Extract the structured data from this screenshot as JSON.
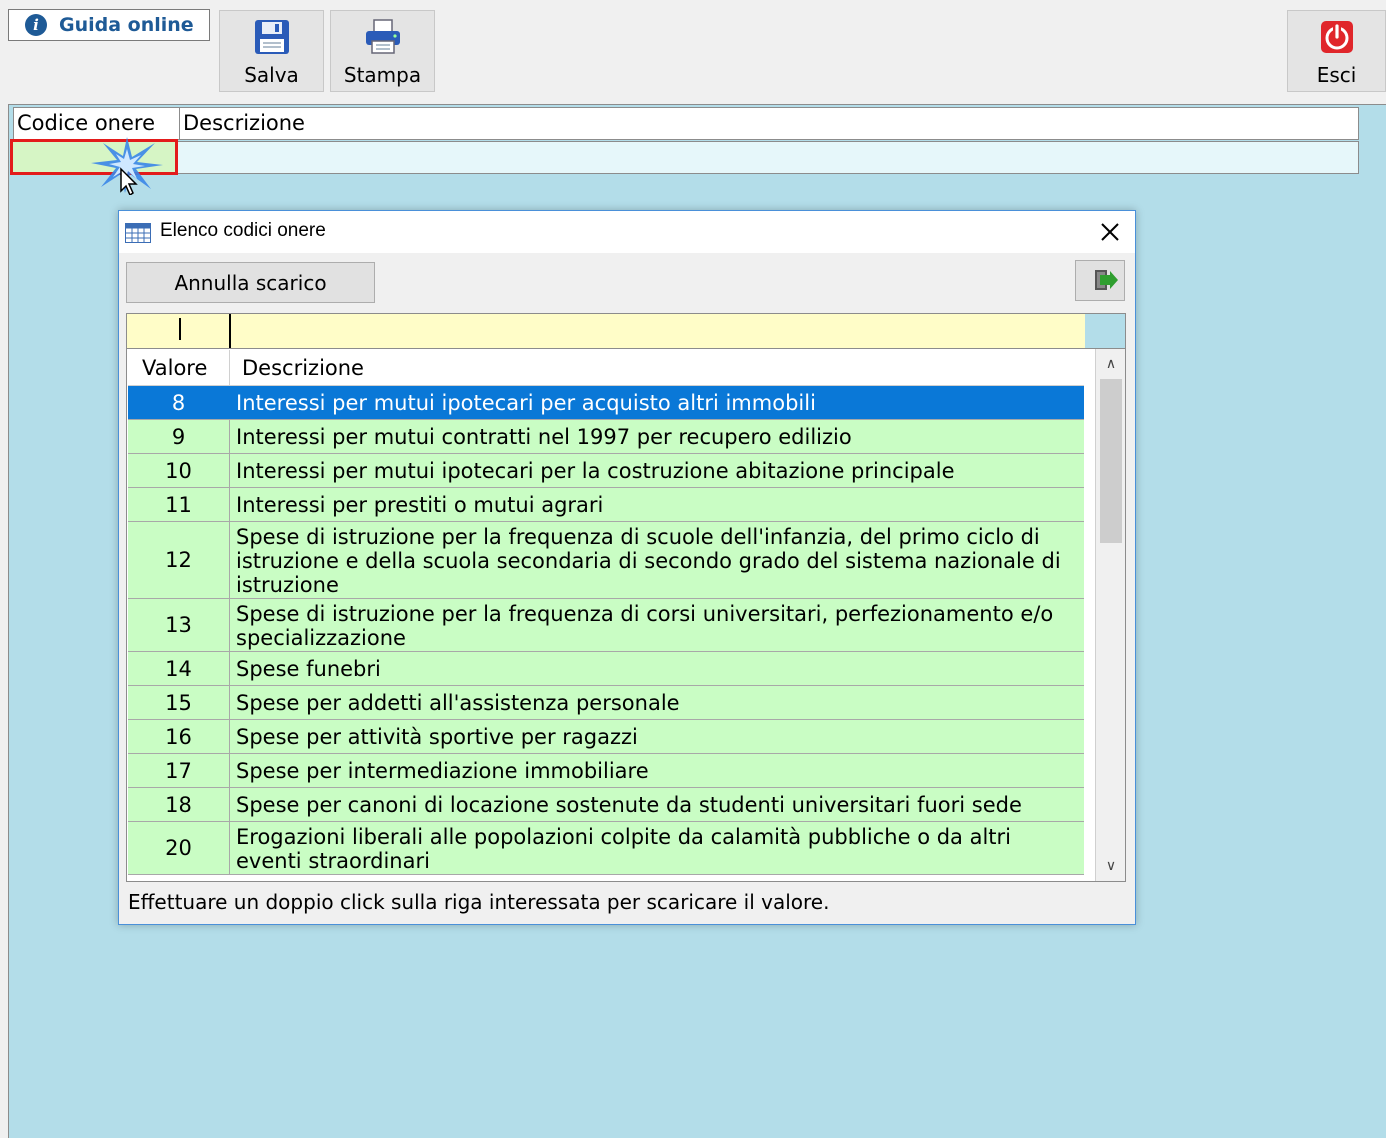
{
  "toolbar": {
    "guida_label": "Guida online",
    "salva_label": "Salva",
    "stampa_label": "Stampa",
    "esci_label": "Esci"
  },
  "form": {
    "col_codice": "Codice onere",
    "col_descrizione": "Descrizione",
    "codice_value": "",
    "descrizione_value": ""
  },
  "dialog": {
    "title": "Elenco codici onere",
    "annulla_label": "Annulla scarico",
    "filter_valore": "",
    "filter_descrizione": "",
    "columns": {
      "valore": "Valore",
      "descrizione": "Descrizione"
    },
    "rows": [
      {
        "valore": "8",
        "descrizione": "Interessi per mutui ipotecari per acquisto altri immobili",
        "selected": true
      },
      {
        "valore": "9",
        "descrizione": "Interessi per mutui contratti nel 1997 per recupero edilizio"
      },
      {
        "valore": "10",
        "descrizione": "Interessi per mutui ipotecari per la costruzione abitazione principale"
      },
      {
        "valore": "11",
        "descrizione": "Interessi per prestiti o mutui agrari"
      },
      {
        "valore": "12",
        "descrizione": "Spese di istruzione per la frequenza di scuole dell'infanzia, del primo ciclo di istruzione e della scuola secondaria di secondo grado del sistema nazionale di istruzione"
      },
      {
        "valore": "13",
        "descrizione": "Spese di istruzione per la frequenza di corsi universitari, perfezionamento e/o specializzazione"
      },
      {
        "valore": "14",
        "descrizione": "Spese funebri"
      },
      {
        "valore": "15",
        "descrizione": "Spese per addetti all'assistenza personale"
      },
      {
        "valore": "16",
        "descrizione": "Spese per attività sportive per ragazzi"
      },
      {
        "valore": "17",
        "descrizione": "Spese per intermediazione immobiliare"
      },
      {
        "valore": "18",
        "descrizione": "Spese per canoni di locazione sostenute da studenti universitari fuori sede"
      },
      {
        "valore": "20",
        "descrizione": "Erogazioni liberali alle popolazioni colpite da calamità pubbliche o da altri eventi straordinari"
      }
    ],
    "hint": "Effettuare un doppio click sulla riga interessata per scaricare il valore."
  },
  "colors": {
    "row_green": "#c9fdc4",
    "row_selected": "#0a78d7",
    "background_blue": "#b3dde9",
    "highlight_red": "#e31b1b",
    "filter_yellow": "#fffdc8"
  },
  "icons": {
    "guida": "info-icon",
    "salva": "floppy-disk-icon",
    "stampa": "printer-icon",
    "esci": "power-icon",
    "dialog": "table-icon",
    "close": "close-icon",
    "export": "export-icon"
  }
}
